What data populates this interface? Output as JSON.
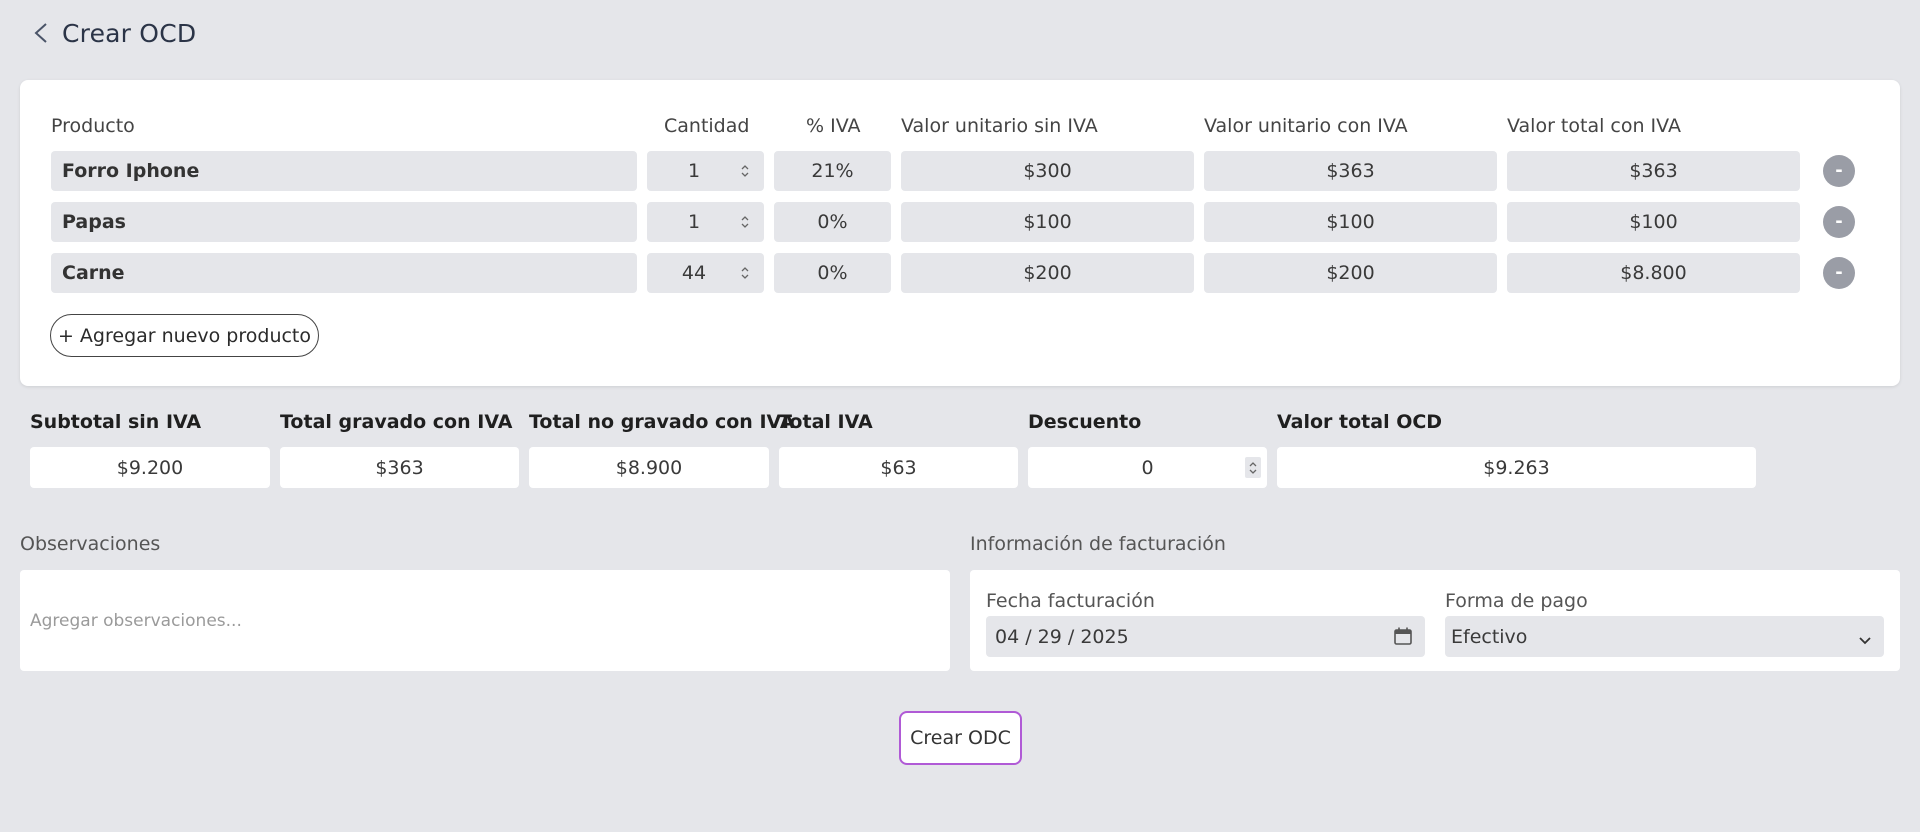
{
  "header": {
    "title": "Crear OCD"
  },
  "table": {
    "headers": {
      "product": "Producto",
      "quantity": "Cantidad",
      "iva": "% IVA",
      "unit_no_iva": "Valor unitario sin IVA",
      "unit_iva": "Valor unitario con IVA",
      "total_iva": "Valor total con IVA"
    },
    "rows": [
      {
        "product": "Forro Iphone",
        "quantity": "1",
        "iva": "21%",
        "unit_no_iva": "$300",
        "unit_iva": "$363",
        "total_iva": "$363",
        "remove": "-"
      },
      {
        "product": "Papas",
        "quantity": "1",
        "iva": "0%",
        "unit_no_iva": "$100",
        "unit_iva": "$100",
        "total_iva": "$100",
        "remove": "-"
      },
      {
        "product": "Carne",
        "quantity": "44",
        "iva": "0%",
        "unit_no_iva": "$200",
        "unit_iva": "$200",
        "total_iva": "$8.800",
        "remove": "-"
      }
    ],
    "add_button": "+ Agregar nuevo producto"
  },
  "summary": {
    "subtotal_label": "Subtotal sin IVA",
    "subtotal_value": "$9.200",
    "gravado_label": "Total gravado con IVA",
    "gravado_value": "$363",
    "no_gravado_label": "Total no gravado con IVA",
    "no_gravado_value": "$8.900",
    "iva_label": "Total IVA",
    "iva_value": "$63",
    "discount_label": "Descuento",
    "discount_value": "0",
    "total_label": "Valor total OCD",
    "total_value": "$9.263"
  },
  "observations": {
    "label": "Observaciones",
    "placeholder": "Agregar observaciones..."
  },
  "billing": {
    "label": "Información de facturación",
    "date_label": "Fecha facturación",
    "date_value": "04 / 29 / 2025",
    "payment_label": "Forma de pago",
    "payment_value": "Efectivo"
  },
  "actions": {
    "create_label": "Crear ODC"
  },
  "colors": {
    "background": "#e5e6ea",
    "accent_border": "#b05ad6",
    "remove_button": "#9a9da6"
  }
}
